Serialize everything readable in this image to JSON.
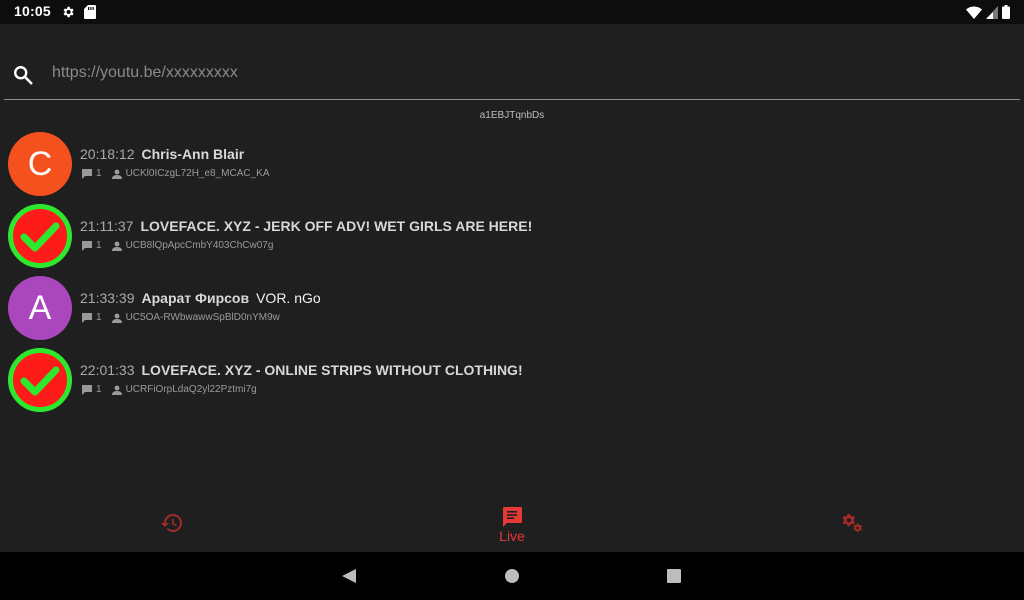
{
  "status_bar": {
    "time": "10:05",
    "left_icons": [
      "gear-icon",
      "sd-card-icon"
    ],
    "right_icons": [
      "wifi-icon",
      "cell-signal-icon",
      "battery-icon"
    ]
  },
  "search": {
    "placeholder": "https://youtu.be/xxxxxxxxx",
    "value": ""
  },
  "video_id": "a1EBJTqnbDs",
  "messages": [
    {
      "time": "20:18:12",
      "author": "Chris-Ann Blair",
      "text": "",
      "avatar_letter": "C",
      "avatar_color": "#f4511e",
      "count": "1",
      "channel_id": "UCKl0ICzgL72H_e8_MCAC_KA"
    },
    {
      "time": "21:11:37",
      "author": "LOVEFACE. XYZ - JERK OFF ADV! WET GIRLS ARE HERE!",
      "text": "",
      "avatar_letter": "",
      "avatar_color": "#ff1a1a",
      "count": "1",
      "channel_id": "UCB8lQpApcCmbY403ChCw07g"
    },
    {
      "time": "21:33:39",
      "author": "Арарат Фирсов",
      "text": "VOR. nGo",
      "avatar_letter": "A",
      "avatar_color": "#ab47bc",
      "count": "1",
      "channel_id": "UC5OA-RWbwawwSpBlD0nYM9w"
    },
    {
      "time": "22:01:33",
      "author": "LOVEFACE. XYZ - ONLINE STRIPS WITHOUT CLOTHING!",
      "text": "",
      "avatar_letter": "",
      "avatar_color": "#ff1a1a",
      "count": "1",
      "channel_id": "UCRFiOrpLdaQ2yl22Pztmi7g"
    }
  ],
  "bottom_nav": {
    "items": [
      {
        "icon": "history-icon",
        "label": ""
      },
      {
        "icon": "chat-icon",
        "label": "Live"
      },
      {
        "icon": "settings-gears-icon",
        "label": ""
      }
    ],
    "active": "Live",
    "accent_color": "#e53935"
  },
  "system_nav": {
    "icons": [
      "back-icon",
      "home-icon",
      "recents-icon"
    ]
  },
  "colors": {
    "background": "#1f1f1f",
    "status_bar": "#0d0d0d",
    "nav_bar": "#000000",
    "check_green": "#2ee82e",
    "check_red": "#ff1a1a"
  }
}
